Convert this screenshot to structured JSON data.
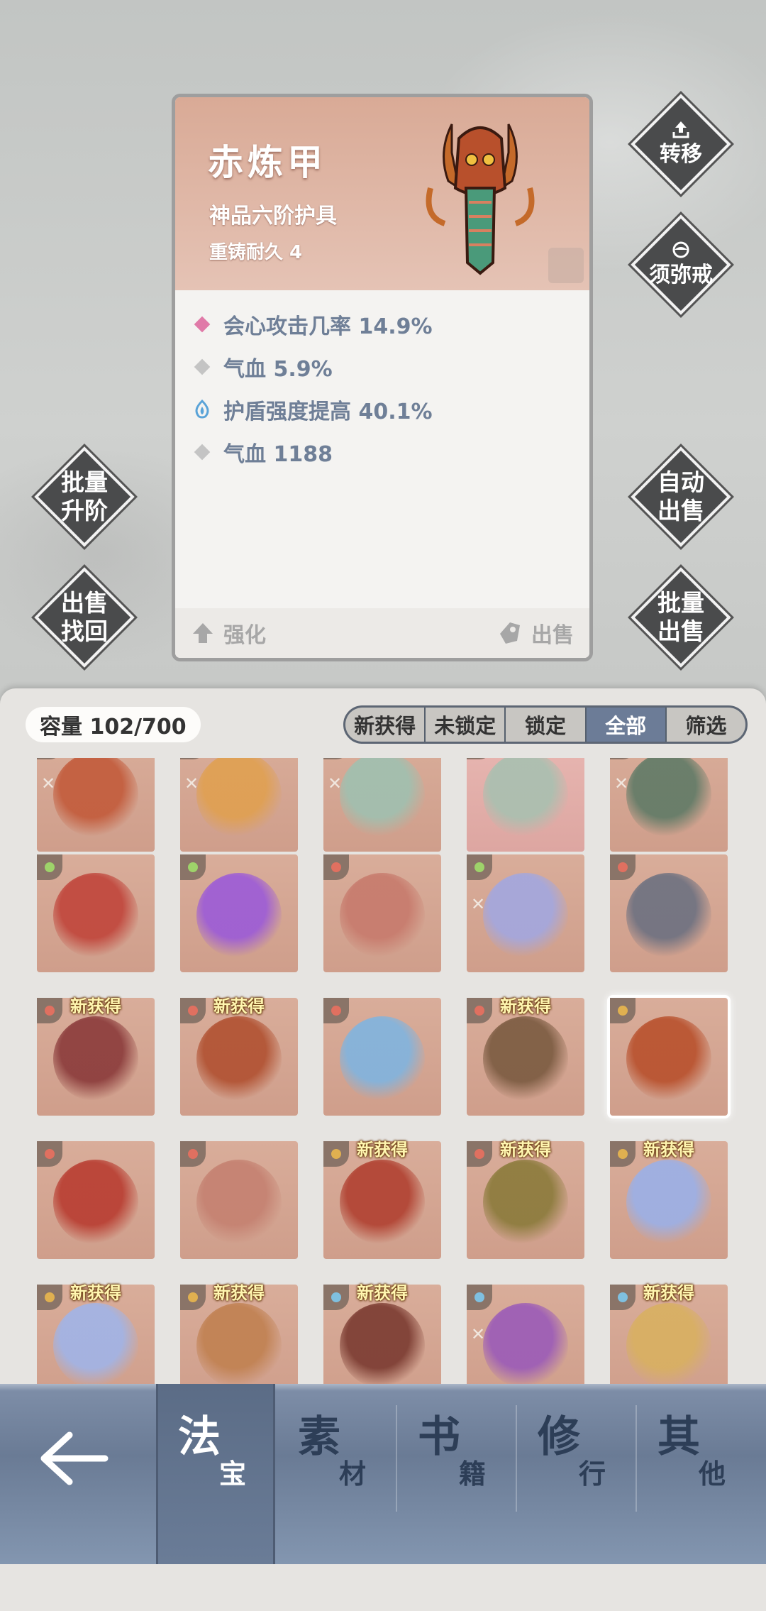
{
  "item": {
    "name": "赤炼甲",
    "grade": "神品六阶护具",
    "reforge": "重铸耐久 4",
    "stats": [
      {
        "icon": "pink-diamond-icon",
        "text": "会心攻击几率 14.9%",
        "color": "#e07aa8"
      },
      {
        "icon": "gray-diamond-icon",
        "text": "气血 5.9%",
        "color": "#c4c4c4"
      },
      {
        "icon": "blue-flame-icon",
        "text": "护盾强度提高 40.1%",
        "color": "#5aa3d8"
      },
      {
        "icon": "gray-diamond-icon",
        "text": "气血 1188",
        "color": "#c4c4c4"
      }
    ],
    "enhance_label": "强化",
    "sell_label": "出售"
  },
  "side_buttons": {
    "transfer": "转移",
    "sumeru_ring": "须弥戒",
    "batch_upgrade": [
      "批量",
      "升阶"
    ],
    "sell_recover": [
      "出售",
      "找回"
    ],
    "auto_sell": [
      "自动",
      "出售"
    ],
    "batch_sell": [
      "批量",
      "出售"
    ]
  },
  "inventory": {
    "capacity": "容量 102/700",
    "filters": [
      "新获得",
      "未锁定",
      "锁定",
      "全部",
      "筛选"
    ],
    "active_filter": "全部",
    "new_label": "新获得",
    "tiles": [
      {
        "new": false,
        "tone": "#c25a3a",
        "slot": "#c25a3a",
        "locked": true
      },
      {
        "new": false,
        "tone": "#e0a050",
        "slot": "#e0a050",
        "locked": true
      },
      {
        "new": false,
        "tone": "#9fc0b0",
        "slot": "#9fc0b0",
        "locked": true
      },
      {
        "new": false,
        "tone": "#a8c0b0",
        "slot": "#a8c0b0",
        "locked": false,
        "pink": true
      },
      {
        "new": false,
        "tone": "#5f7a66",
        "slot": "#5f7a66",
        "locked": true
      },
      {
        "new": false,
        "tone": "#c0443a",
        "slot": "#9ed36a",
        "locked": false
      },
      {
        "new": false,
        "tone": "#9b5ad8",
        "slot": "#9ed36a",
        "locked": false
      },
      {
        "new": false,
        "tone": "#c77a6c",
        "slot": "#e07060",
        "locked": false
      },
      {
        "new": false,
        "tone": "#a2a7e0",
        "slot": "#9ed36a",
        "locked": true
      },
      {
        "new": false,
        "tone": "#6c7080",
        "slot": "#e07060",
        "locked": false
      },
      {
        "new": true,
        "tone": "#8a3a3a",
        "slot": "#e07060",
        "locked": false
      },
      {
        "new": true,
        "tone": "#b05030",
        "slot": "#e07060",
        "locked": false
      },
      {
        "new": false,
        "tone": "#7fb4e0",
        "slot": "#e07060",
        "locked": false
      },
      {
        "new": true,
        "tone": "#7a5a40",
        "slot": "#e07060",
        "locked": false
      },
      {
        "new": false,
        "tone": "#b8502c",
        "slot": "#e0b050",
        "locked": false,
        "selected": true
      },
      {
        "new": false,
        "tone": "#b83c30",
        "slot": "#e07060",
        "locked": false
      },
      {
        "new": false,
        "tone": "#c48070",
        "slot": "#e07060",
        "locked": false
      },
      {
        "new": true,
        "tone": "#b04030",
        "slot": "#e0b050",
        "locked": false
      },
      {
        "new": true,
        "tone": "#8a7a3a",
        "slot": "#e07060",
        "locked": false
      },
      {
        "new": true,
        "tone": "#9ab0e8",
        "slot": "#e0b050",
        "locked": false
      },
      {
        "new": true,
        "tone": "#a0b4e8",
        "slot": "#e0b050",
        "locked": false
      },
      {
        "new": true,
        "tone": "#c08050",
        "slot": "#e0b050",
        "locked": false
      },
      {
        "new": true,
        "tone": "#7a3a30",
        "slot": "#7fc0e0",
        "locked": false
      },
      {
        "new": false,
        "tone": "#9a5ab8",
        "slot": "#7fc0e0",
        "locked": true
      },
      {
        "new": true,
        "tone": "#d8b060",
        "slot": "#7fc0e0",
        "locked": false
      }
    ]
  },
  "nav": {
    "tabs": [
      {
        "big": "法",
        "small": "宝",
        "active": true
      },
      {
        "big": "素",
        "small": "材",
        "active": false
      },
      {
        "big": "书",
        "small": "籍",
        "active": false
      },
      {
        "big": "修",
        "small": "行",
        "active": false
      },
      {
        "big": "其",
        "small": "他",
        "active": false
      }
    ]
  }
}
